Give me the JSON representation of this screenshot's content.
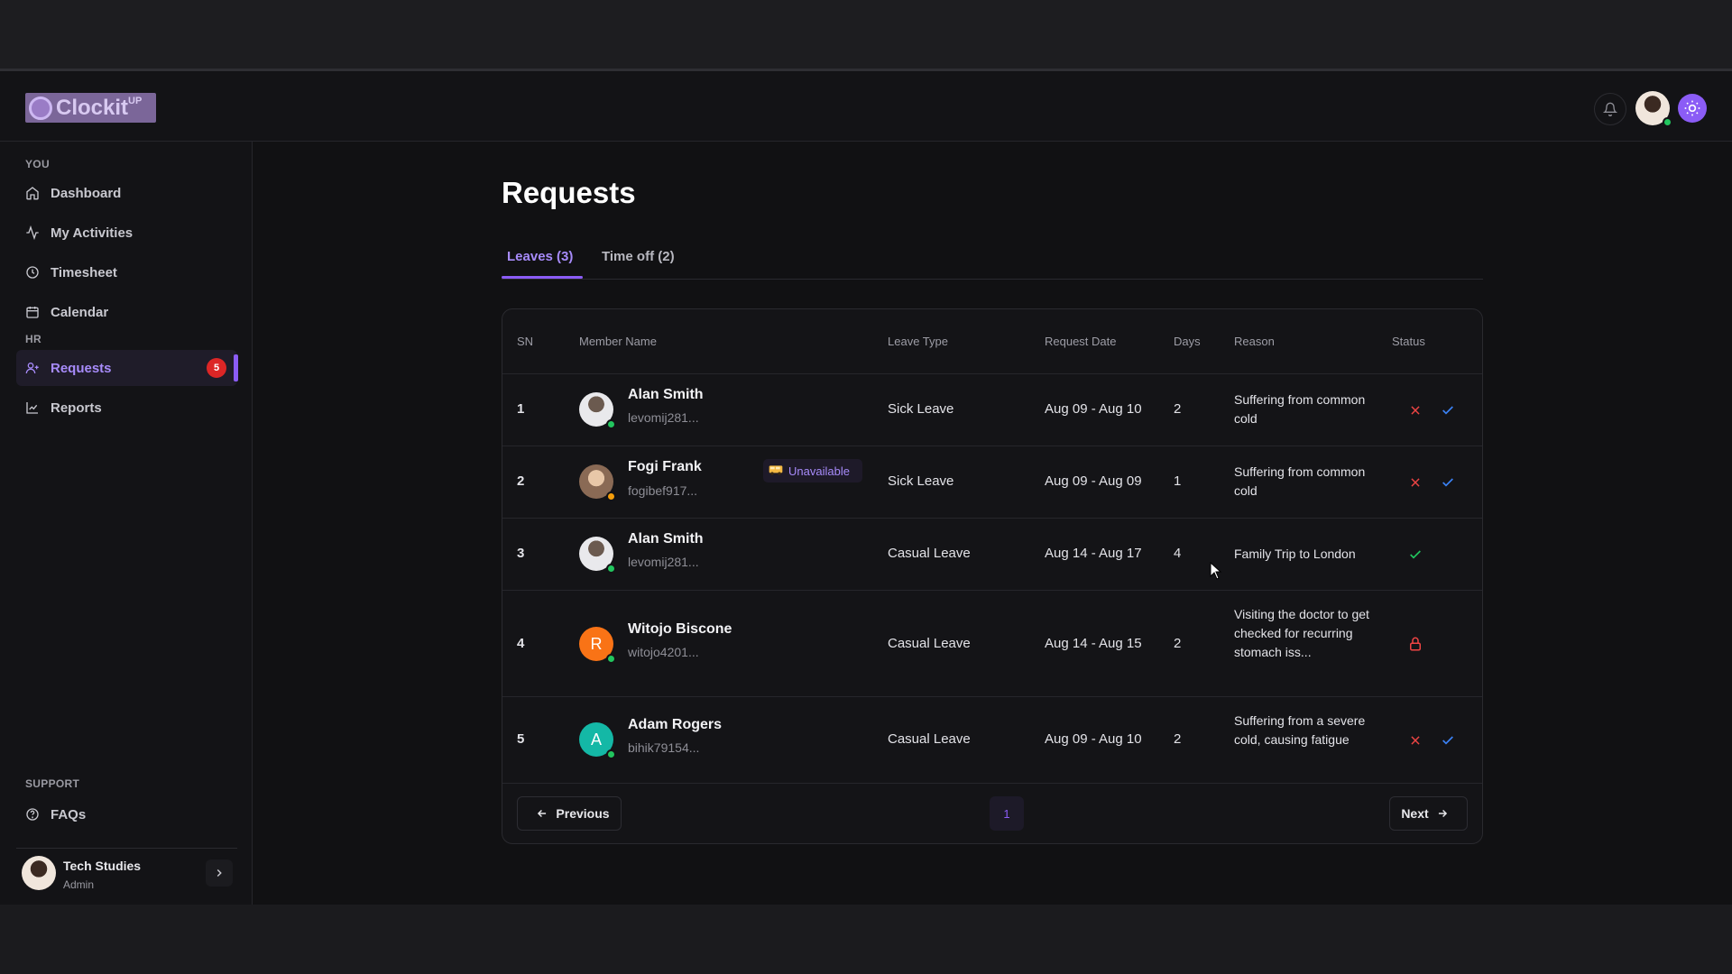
{
  "app": {
    "logo_text": "Clockit",
    "logo_sup": "UP"
  },
  "sidebar": {
    "you_label": "YOU",
    "items": [
      {
        "label": "Dashboard"
      },
      {
        "label": "My Activities"
      },
      {
        "label": "Timesheet"
      },
      {
        "label": "Calendar"
      }
    ],
    "hr_label": "HR",
    "hr_items": [
      {
        "label": "Requests",
        "badge": "5"
      },
      {
        "label": "Reports"
      }
    ],
    "support_label": "SUPPORT",
    "support_items": [
      {
        "label": "FAQs"
      }
    ],
    "user": {
      "name": "Tech Studies",
      "role": "Admin"
    }
  },
  "page": {
    "title": "Requests",
    "tabs": [
      {
        "label": "Leaves  (3)"
      },
      {
        "label": "Time off (2)"
      }
    ]
  },
  "table": {
    "headers": [
      "SN",
      "Member Name",
      "Leave Type",
      "Request Date",
      "Days",
      "Reason",
      "Status"
    ],
    "rows": [
      {
        "sn": "1",
        "name": "Alan Smith",
        "email": "levomij281...",
        "type": "Sick Leave",
        "date": "Aug 09 - Aug 10",
        "days": "2",
        "reason": "Suffering from common cold"
      },
      {
        "sn": "2",
        "name": "Fogi Frank",
        "email": "fogibef917...",
        "badge": "Unavailable",
        "type": "Sick Leave",
        "date": "Aug 09 - Aug 09",
        "days": "1",
        "reason": "Suffering from common cold"
      },
      {
        "sn": "3",
        "name": "Alan Smith",
        "email": "levomij281...",
        "type": "Casual Leave",
        "date": "Aug 14 - Aug 17",
        "days": "4",
        "reason": "Family Trip to London"
      },
      {
        "sn": "4",
        "name": "Witojo Biscone",
        "email": "witojo4201...",
        "avatar_letter": "R",
        "type": "Casual Leave",
        "date": "Aug 14 - Aug 15",
        "days": "2",
        "reason": "Visiting the doctor to get checked for recurring stomach iss..."
      },
      {
        "sn": "5",
        "name": "Adam Rogers",
        "email": "bihik79154...",
        "avatar_letter": "A",
        "type": "Casual Leave",
        "date": "Aug 09 - Aug 10",
        "days": "2",
        "reason": "Suffering from a severe cold, causing fatigue"
      }
    ]
  },
  "pagination": {
    "previous": "Previous",
    "next": "Next",
    "current": "1"
  },
  "colors": {
    "accent": "#8b5cf6",
    "reject": "#ef4444",
    "approve": "#3b82f6",
    "approved": "#22c55e",
    "online": "#22c55e"
  }
}
